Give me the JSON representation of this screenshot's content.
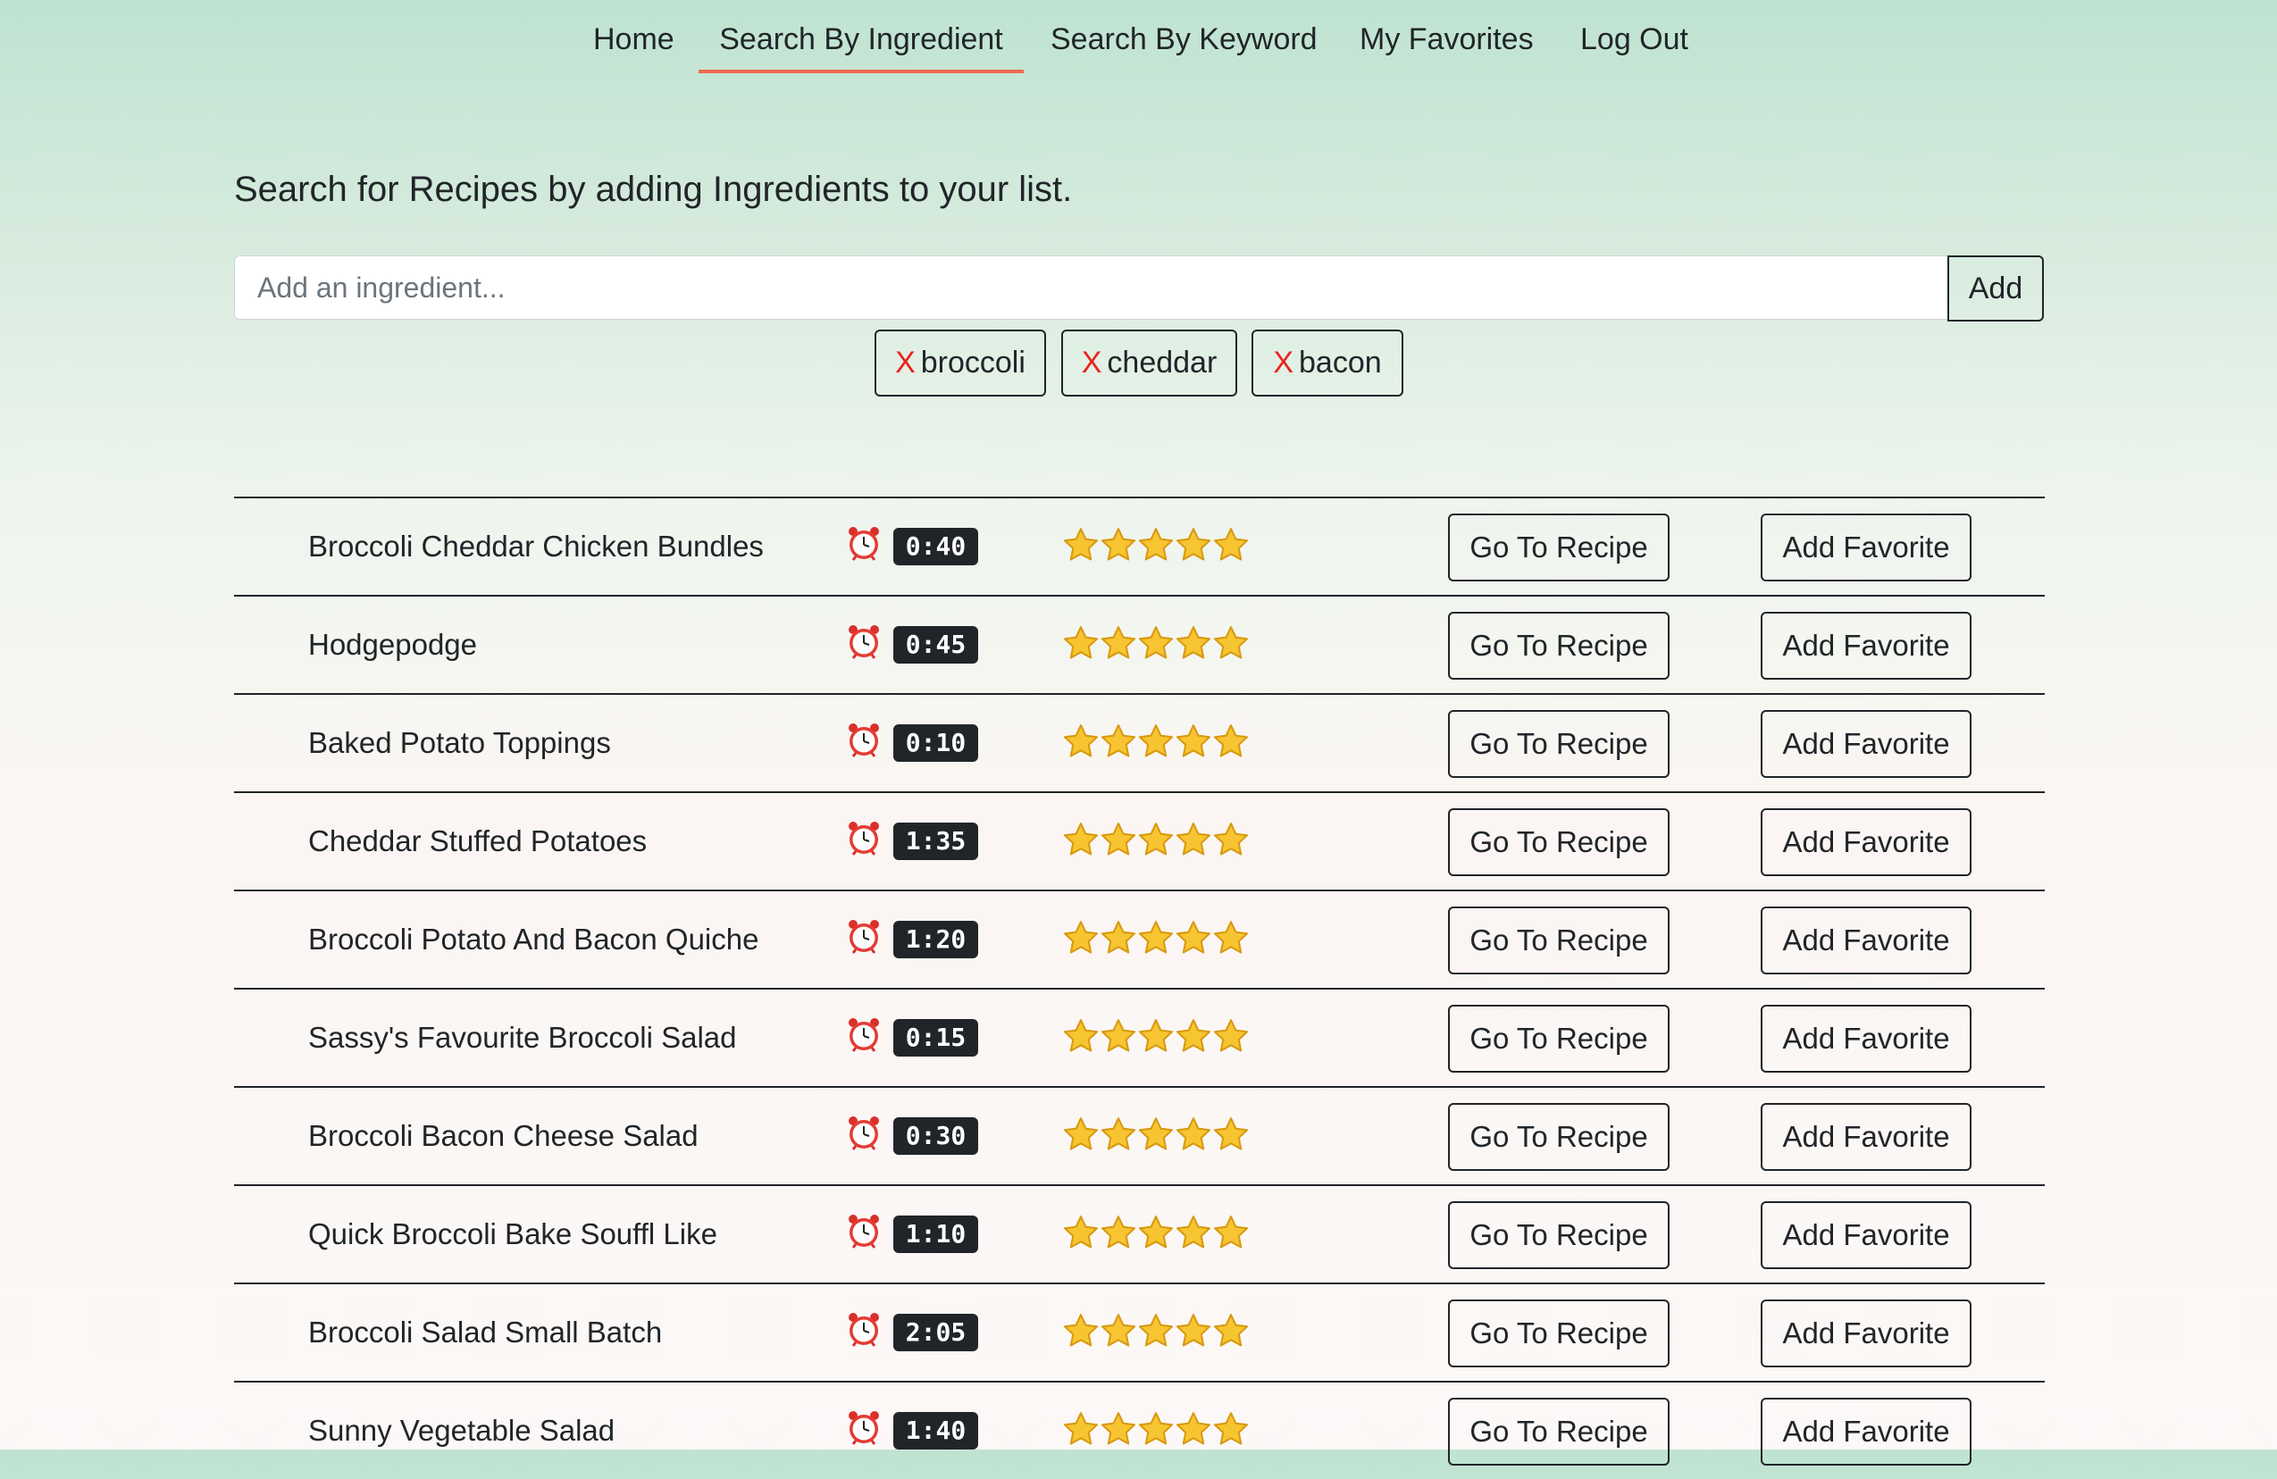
{
  "nav": {
    "items": [
      {
        "label": "Home",
        "active": false
      },
      {
        "label": "Search By Ingredient",
        "active": true
      },
      {
        "label": "Search By Keyword",
        "active": false
      },
      {
        "label": "My Favorites",
        "active": false
      },
      {
        "label": "Log Out",
        "active": false
      }
    ],
    "active_color": "#ef6a4c"
  },
  "search": {
    "heading": "Search for Recipes by adding Ingredients to your list.",
    "placeholder": "Add an ingredient...",
    "value": "",
    "add_label": "Add"
  },
  "ingredients": [
    {
      "remove": "X",
      "label": "broccoli"
    },
    {
      "remove": "X",
      "label": "cheddar"
    },
    {
      "remove": "X",
      "label": "bacon"
    }
  ],
  "recipes": [
    {
      "name": "Broccoli Cheddar Chicken Bundles",
      "time": "0:40",
      "stars": 5,
      "go_label": "Go To Recipe",
      "fav_label": "Add Favorite"
    },
    {
      "name": "Hodgepodge",
      "time": "0:45",
      "stars": 5,
      "go_label": "Go To Recipe",
      "fav_label": "Add Favorite"
    },
    {
      "name": "Baked Potato Toppings",
      "time": "0:10",
      "stars": 5,
      "go_label": "Go To Recipe",
      "fav_label": "Add Favorite"
    },
    {
      "name": "Cheddar Stuffed Potatoes",
      "time": "1:35",
      "stars": 5,
      "go_label": "Go To Recipe",
      "fav_label": "Add Favorite"
    },
    {
      "name": "Broccoli Potato And Bacon Quiche",
      "time": "1:20",
      "stars": 5,
      "go_label": "Go To Recipe",
      "fav_label": "Add Favorite"
    },
    {
      "name": "Sassy's Favourite Broccoli Salad",
      "time": "0:15",
      "stars": 5,
      "go_label": "Go To Recipe",
      "fav_label": "Add Favorite"
    },
    {
      "name": "Broccoli Bacon Cheese Salad",
      "time": "0:30",
      "stars": 5,
      "go_label": "Go To Recipe",
      "fav_label": "Add Favorite"
    },
    {
      "name": "Quick Broccoli Bake Souffl Like",
      "time": "1:10",
      "stars": 5,
      "go_label": "Go To Recipe",
      "fav_label": "Add Favorite"
    },
    {
      "name": "Broccoli Salad Small Batch",
      "time": "2:05",
      "stars": 5,
      "go_label": "Go To Recipe",
      "fav_label": "Add Favorite"
    },
    {
      "name": "Sunny Vegetable Salad",
      "time": "1:40",
      "stars": 5,
      "go_label": "Go To Recipe",
      "fav_label": "Add Favorite"
    }
  ],
  "icons": {
    "timer": "alarm-clock-icon",
    "rating": "star-icon",
    "remove": "x-icon"
  }
}
